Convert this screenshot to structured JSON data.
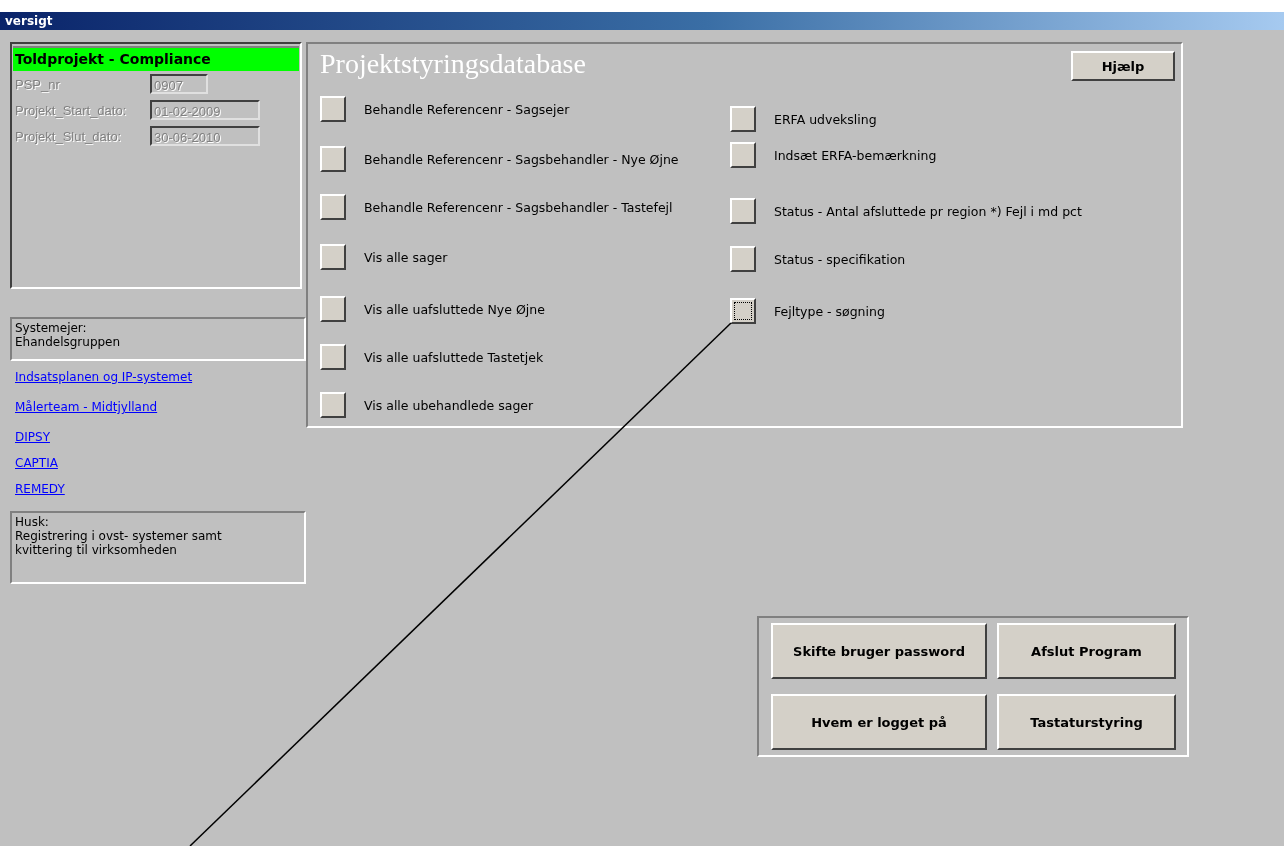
{
  "window": {
    "title": "versigt"
  },
  "project": {
    "title": "Toldprojekt - Compliance",
    "fields": [
      {
        "label": "PSP_nr",
        "value": "0907",
        "disabled": true
      },
      {
        "label": "Projekt_Start_dato:",
        "value": "01-02-2009",
        "disabled": true
      },
      {
        "label": "Projekt_Slut_dato:",
        "value": "30-06-2010",
        "disabled": true
      }
    ]
  },
  "owner": {
    "label": "Systemejer:",
    "value": "Ehandelsgruppen"
  },
  "links": [
    "Indsatsplanen og IP-systemet",
    "Målerteam -  Midtjylland",
    "DIPSY",
    "CAPTIA",
    "REMEDY"
  ],
  "reminder": {
    "label": "Husk:",
    "text": "Registrering i ovst- systemer samt kvittering til virksomheden"
  },
  "main": {
    "title": "Projektstyringsdatabase",
    "help_button": "Hjælp",
    "left_actions": [
      {
        "label": "Behandle  Referencenr - Sagsejer",
        "focused": false
      },
      {
        "label": "Behandle Referencenr - Sagsbehandler - Nye Øjne",
        "focused": false
      },
      {
        "label": "Behandle Referencenr - Sagsbehandler - Tastefejl",
        "focused": false
      },
      {
        "label": "Vis alle sager",
        "focused": false
      },
      {
        "label": "Vis alle uafsluttede Nye Øjne",
        "focused": false
      },
      {
        "label": "Vis alle uafsluttede Tastetjek",
        "focused": false
      },
      {
        "label": "Vis alle ubehandlede sager",
        "focused": false
      }
    ],
    "right_actions": [
      {
        "label": "ERFA udveksling",
        "focused": false
      },
      {
        "label": "Indsæt ERFA-bemærkning",
        "focused": false
      },
      {
        "label": "Status - Antal afsluttede pr region   *) Fejl i md pct",
        "focused": false
      },
      {
        "label": "Status - specifikation",
        "focused": false
      },
      {
        "label": "Fejltype - søgning",
        "focused": true
      }
    ]
  },
  "bottom_buttons": [
    "Skifte bruger password",
    "Afslut Program",
    "Hvem er logget på",
    "Tastaturstyring"
  ]
}
